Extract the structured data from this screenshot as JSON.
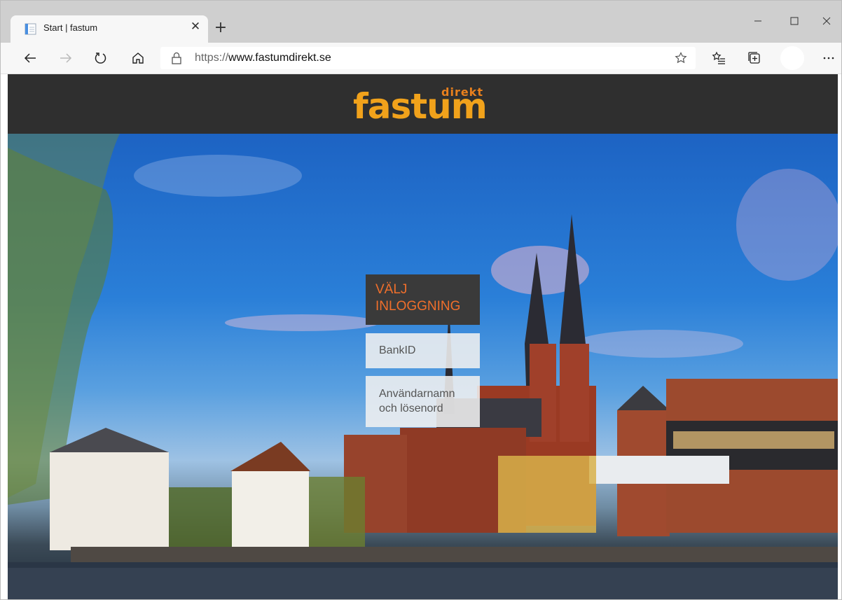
{
  "browser": {
    "tab": {
      "title": "Start | fastum"
    },
    "address": {
      "scheme": "https://",
      "host": "www.fastumdirekt.se"
    }
  },
  "site": {
    "logo": {
      "main": "fastum",
      "sub": "direkt"
    },
    "login": {
      "heading_line1": "VÄLJ",
      "heading_line2": "INLOGGNING",
      "bankid": "BankID",
      "userpass_line1": "Användarnamn",
      "userpass_line2": "och lösenord"
    }
  },
  "colors": {
    "header_bg": "#2f2f2f",
    "logo_main": "#f1a21b",
    "logo_sub": "#e8801d",
    "login_heading_text": "#f06f2b",
    "login_heading_bg": "#3a3a3a"
  }
}
